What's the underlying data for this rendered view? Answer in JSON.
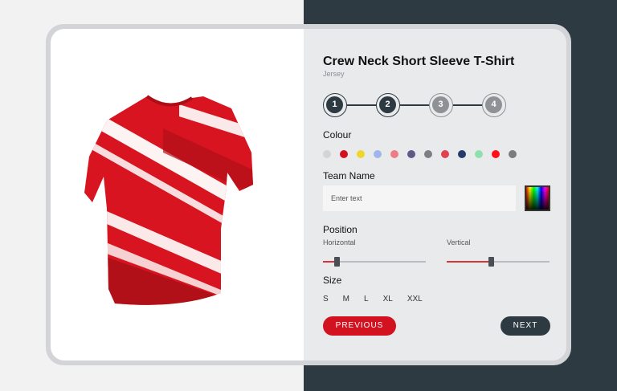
{
  "product": {
    "title": "Crew Neck Short Sleeve T-Shirt",
    "subtitle": "Jersey"
  },
  "stepper": {
    "steps": [
      {
        "label": "1",
        "state": "active"
      },
      {
        "label": "2",
        "state": "active"
      },
      {
        "label": "3",
        "state": "inactive"
      },
      {
        "label": "4",
        "state": "inactive"
      }
    ]
  },
  "colour": {
    "label": "Colour",
    "swatches": [
      "#d3d4d6",
      "#d3121f",
      "#f0d62c",
      "#9fb6ea",
      "#eb7d86",
      "#5e5a88",
      "#7d7f82",
      "#e04250",
      "#243c6b",
      "#8ee0b0",
      "#ff0f18",
      "#7a7c7e"
    ]
  },
  "team_name": {
    "label": "Team Name",
    "placeholder": "Enter text",
    "value": ""
  },
  "position": {
    "label": "Position",
    "horizontal": {
      "label": "Horizontal",
      "value": 0.13
    },
    "vertical": {
      "label": "Vertical",
      "value": 0.43
    }
  },
  "size": {
    "label": "Size",
    "options": [
      "S",
      "M",
      "L",
      "XL",
      "XXL"
    ]
  },
  "buttons": {
    "previous": "PREVIOUS",
    "next": "NEXT"
  },
  "colors": {
    "accent": "#d3121f",
    "dark": "#2d3a42"
  }
}
